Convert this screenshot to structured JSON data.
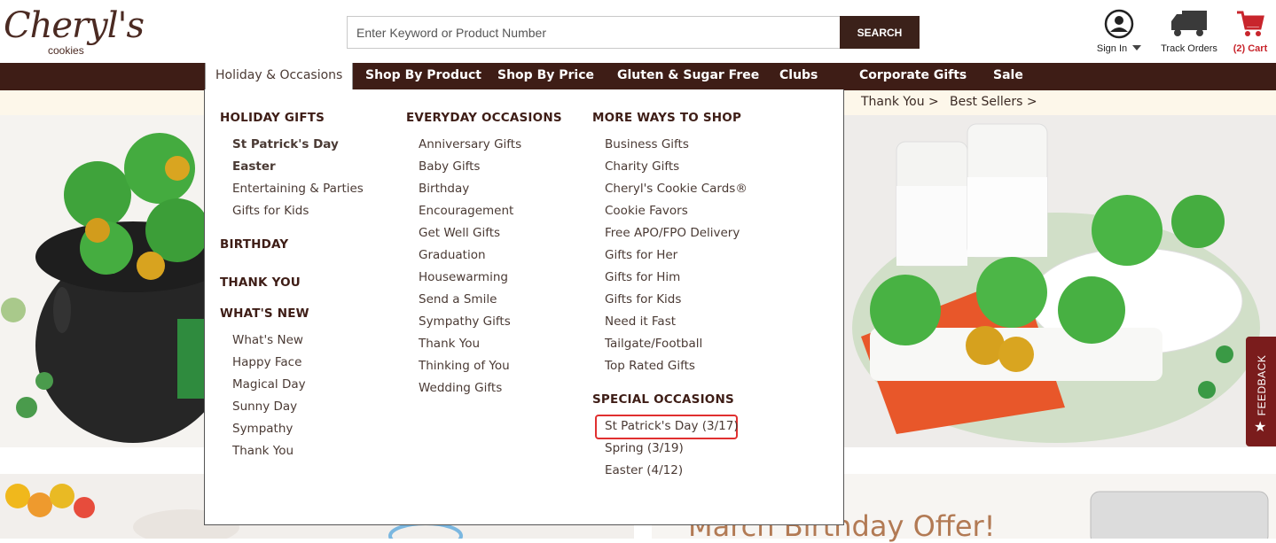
{
  "brand": {
    "logo_script": "Cheryl's",
    "logo_sub": "cookies"
  },
  "search": {
    "placeholder": "Enter Keyword or Product Number",
    "button": "SEARCH"
  },
  "utility": {
    "signin": "Sign In",
    "track": "Track Orders",
    "cart": "(2)  Cart"
  },
  "nav": {
    "items": [
      "Holiday & Occasions",
      "Shop By Product",
      "Shop By Price",
      "Gluten & Sugar Free",
      "Clubs",
      "Corporate Gifts",
      "Sale"
    ]
  },
  "promo": {
    "links": [
      "Thank You >",
      "Best Sellers >"
    ]
  },
  "banner": {
    "bottom_title": "March Birthday Offer!"
  },
  "feedback": "FEEDBACK",
  "menu": {
    "holiday_gifts": {
      "heading": "HOLIDAY GIFTS",
      "items": [
        "St Patrick's Day",
        "Easter",
        "Entertaining & Parties",
        "Gifts for Kids"
      ]
    },
    "birthday": {
      "heading": "BIRTHDAY"
    },
    "thank_you": {
      "heading": "THANK YOU"
    },
    "whats_new": {
      "heading": "WHAT'S NEW",
      "items": [
        "What's New",
        "Happy Face",
        "Magical Day",
        "Sunny Day",
        "Sympathy",
        "Thank You"
      ]
    },
    "everyday": {
      "heading": "EVERYDAY OCCASIONS",
      "items": [
        "Anniversary Gifts",
        "Baby Gifts",
        "Birthday",
        "Encouragement",
        "Get Well Gifts",
        "Graduation",
        "Housewarming",
        "Send a Smile",
        "Sympathy Gifts",
        "Thank You",
        "Thinking of You",
        "Wedding Gifts"
      ]
    },
    "more_ways": {
      "heading": "MORE WAYS TO SHOP",
      "items": [
        "Business Gifts",
        "Charity Gifts",
        "Cheryl's Cookie Cards®",
        "Cookie Favors",
        "Free APO/FPO Delivery",
        "Gifts for Her",
        "Gifts for Him",
        "Gifts for Kids",
        "Need it Fast",
        "Tailgate/Football",
        "Top Rated Gifts"
      ]
    },
    "special": {
      "heading": "SPECIAL OCCASIONS",
      "items": [
        "St Patrick's Day (3/17)",
        "Spring (3/19)",
        "Easter (4/12)"
      ]
    }
  },
  "colors": {
    "brand_brown": "#3e1d16",
    "cart_red": "#c8252c",
    "highlight": "#e03030"
  }
}
